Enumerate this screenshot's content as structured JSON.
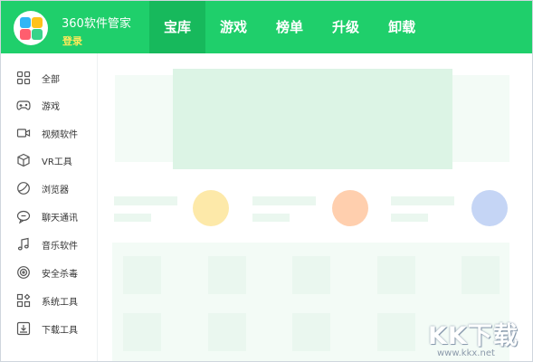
{
  "header": {
    "app_title": "360软件管家",
    "login_label": "登录",
    "accent_color": "#1fcf6b",
    "tabs": [
      {
        "label": "宝库",
        "active": true
      },
      {
        "label": "游戏",
        "active": false
      },
      {
        "label": "榜单",
        "active": false
      },
      {
        "label": "升级",
        "active": false
      },
      {
        "label": "卸载",
        "active": false
      }
    ]
  },
  "sidebar": {
    "items": [
      {
        "label": "全部",
        "icon": "grid-icon"
      },
      {
        "label": "游戏",
        "icon": "gamepad-icon"
      },
      {
        "label": "视频软件",
        "icon": "video-camera-icon"
      },
      {
        "label": "VR工具",
        "icon": "vr-cube-icon"
      },
      {
        "label": "浏览器",
        "icon": "browser-icon"
      },
      {
        "label": "聊天通讯",
        "icon": "chat-bubble-icon"
      },
      {
        "label": "音乐软件",
        "icon": "music-note-icon"
      },
      {
        "label": "安全杀毒",
        "icon": "shield-target-icon"
      },
      {
        "label": "系统工具",
        "icon": "system-tools-icon"
      },
      {
        "label": "下载工具",
        "icon": "download-tray-icon"
      }
    ]
  },
  "placeholder_colors": {
    "yellow": "#fde9a9",
    "orange": "#ffcfae",
    "blue": "#c5d5f5"
  },
  "watermark": {
    "text": "KK下载",
    "url": "www.kkx.net"
  }
}
